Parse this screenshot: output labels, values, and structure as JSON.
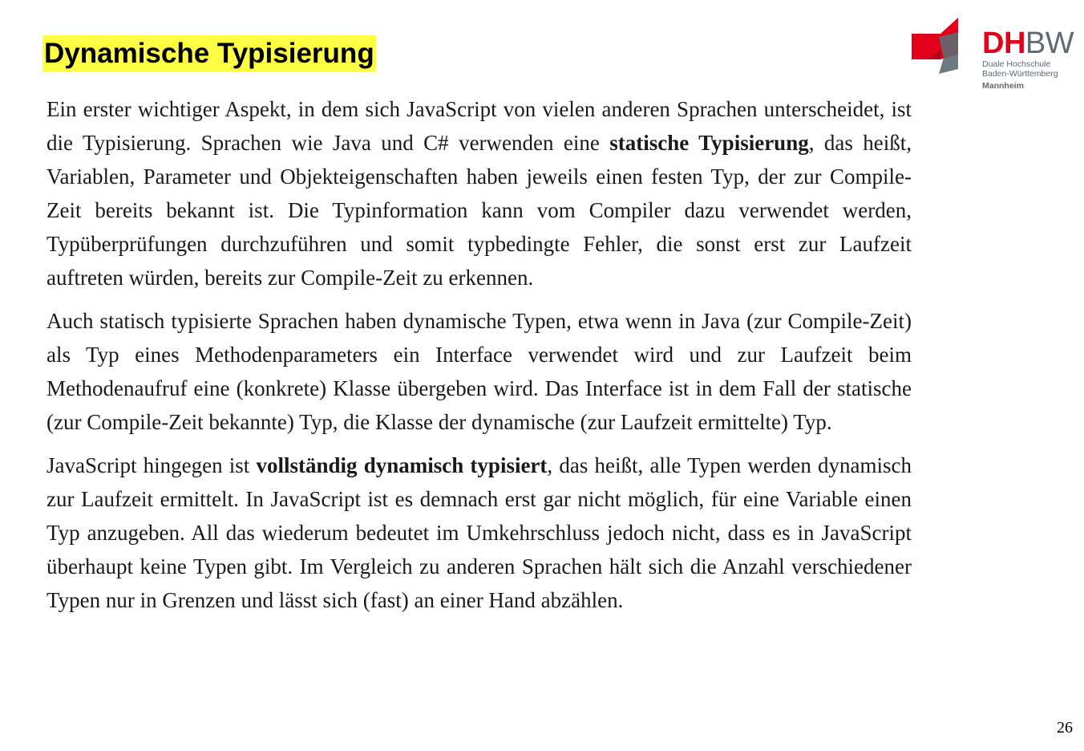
{
  "title": "Dynamische Typisierung",
  "logo": {
    "dh": "DH",
    "bw": "BW",
    "line1": "Duale Hochschule",
    "line2": "Baden-Württemberg",
    "city": "Mannheim"
  },
  "paragraphs": {
    "p1": {
      "t1": "Ein erster wichtiger Aspekt, in dem sich JavaScript von vielen anderen Sprachen unterscheidet, ist die Typisierung. Sprachen wie Java und C# verwenden eine ",
      "b1": "statische Typisierung",
      "t2": ", das heißt, Variablen, Parameter und Objekteigenschaften haben jeweils einen festen Typ, der zur Compile-Zeit bereits bekannt ist. Die Typinformation kann vom Compiler dazu verwendet werden, Typüberprüfungen durchzuführen und somit typbedingte Fehler, die sonst erst zur Laufzeit auftreten würden, bereits zur Compile-Zeit zu erkennen."
    },
    "p2": "Auch statisch typisierte Sprachen haben dynamische Typen, etwa wenn in Java (zur Compile-Zeit) als Typ eines Methodenparameters ein Interface verwendet wird und zur Laufzeit beim Methodenaufruf eine (konkrete) Klasse übergeben wird. Das Interface ist in dem Fall der statische (zur Compile-Zeit bekannte) Typ, die Klasse der dynamische (zur Laufzeit ermittelte) Typ.",
    "p3": {
      "t1": "JavaScript hingegen ist ",
      "b1": "vollständig dynamisch typisiert",
      "t2": ", das heißt, alle Typen werden dynamisch zur Laufzeit ermittelt. In JavaScript ist es demnach erst gar nicht möglich, für eine Variable einen Typ anzugeben. All das wiederum bedeutet im Umkehrschluss jedoch nicht, dass es in JavaScript überhaupt keine Typen gibt. Im Vergleich zu anderen Sprachen hält sich die Anzahl verschiedener Typen nur in Grenzen und lässt sich (fast) an einer Hand abzählen."
    }
  },
  "page_number": "26",
  "colors": {
    "title_highlight": "#ffff44",
    "brand_red": "#e2001a",
    "brand_gray": "#5f6a72"
  }
}
